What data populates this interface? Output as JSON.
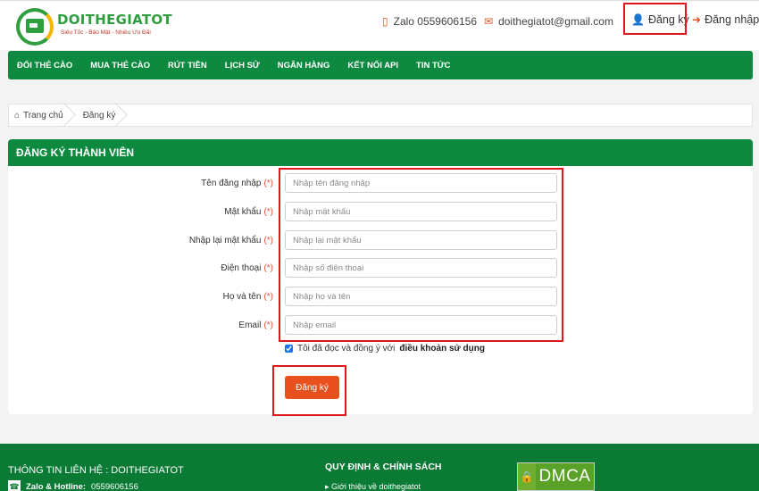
{
  "brand": {
    "name": "DOITHEGIATOT",
    "tagline": "Siêu Tốc - Bảo Mật - Nhiều Ưu Đãi"
  },
  "header": {
    "zalo": "Zalo 0559606156",
    "email": "doithegiatot@gmail.com",
    "register": "Đăng ký",
    "login": "Đăng nhập"
  },
  "nav": {
    "items": [
      "ĐỔI THẺ CÀO",
      "MUA THẺ CÀO",
      "RÚT TIỀN",
      "LỊCH SỬ",
      "NGÂN HÀNG",
      "KẾT NỐI API",
      "TIN TỨC"
    ]
  },
  "breadcrumb": {
    "home": "Trang chủ",
    "current": "Đăng ký"
  },
  "form": {
    "title": "ĐĂNG KÝ THÀNH VIÊN",
    "required_mark": "(*)",
    "fields": [
      {
        "label": "Tên đăng nhập",
        "placeholder": "Nhập tên đăng nhập",
        "value": ""
      },
      {
        "label": "Mật khẩu",
        "placeholder": "Nhập mật khẩu",
        "value": ""
      },
      {
        "label": "Nhập lại mật khẩu",
        "placeholder": "Nhập lại mật khẩu",
        "value": ""
      },
      {
        "label": "Điện thoại",
        "placeholder": "Nhập số điện thoại",
        "value": ""
      },
      {
        "label": "Họ và tên",
        "placeholder": "Nhập họ và tên",
        "value": ""
      },
      {
        "label": "Email",
        "placeholder": "Nhập email",
        "value": ""
      }
    ],
    "agree_text": "Tôi đã đọc và đồng ý với",
    "agree_link": "điều khoản sử dụng",
    "agree_checked": true,
    "submit": "Đăng ký"
  },
  "footer": {
    "contact_title": "THÔNG TIN LIÊN HỆ : DOITHEGIATOT",
    "hotline_label": "Zalo & Hotline:",
    "hotline_value": "0559606156",
    "policy_title": "QUY ĐỊNH & CHÍNH SÁCH",
    "intro_link": "Giới thiệu về doithegiatot",
    "badge": "DMCA"
  },
  "colors": {
    "primary_green": "#0d8a3f",
    "accent_orange": "#e8501e",
    "highlight_red": "#e0161b"
  },
  "icons": {
    "zalo": "phone-icon",
    "email": "envelope-icon",
    "register": "user-plus-icon",
    "login": "sign-in-icon",
    "home": "home-icon"
  }
}
